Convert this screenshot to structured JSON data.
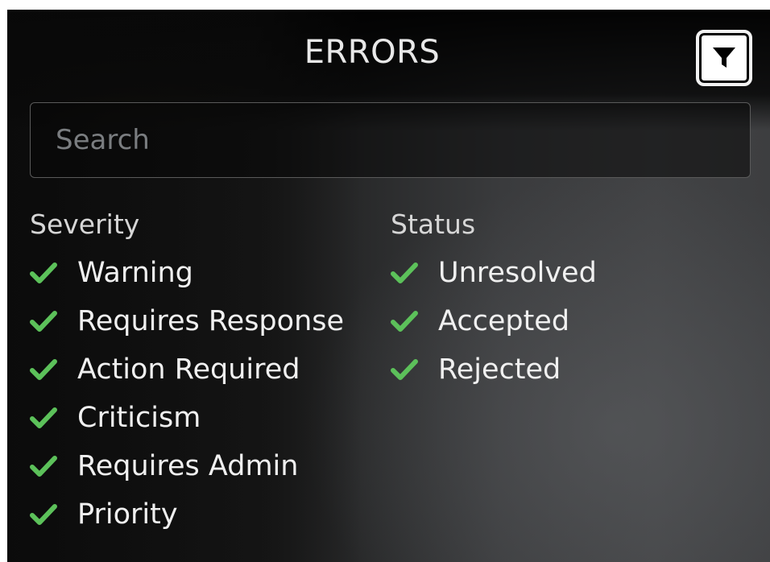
{
  "header": {
    "title": "ERRORS",
    "filter_icon": "funnel-icon"
  },
  "search": {
    "placeholder": "Search",
    "value": ""
  },
  "severity": {
    "label": "Severity",
    "items": [
      {
        "label": "Warning",
        "checked": true
      },
      {
        "label": "Requires Response",
        "checked": true
      },
      {
        "label": "Action Required",
        "checked": true
      },
      {
        "label": "Criticism",
        "checked": true
      },
      {
        "label": "Requires Admin",
        "checked": true
      },
      {
        "label": "Priority",
        "checked": true
      }
    ]
  },
  "status": {
    "label": "Status",
    "items": [
      {
        "label": "Unresolved",
        "checked": true
      },
      {
        "label": "Accepted",
        "checked": true
      },
      {
        "label": "Rejected",
        "checked": true
      }
    ]
  },
  "colors": {
    "check": "#5cc15a",
    "text": "#f0f0f0",
    "panel": "#1a1a1a"
  },
  "icons": {
    "check": "checkmark-icon"
  }
}
